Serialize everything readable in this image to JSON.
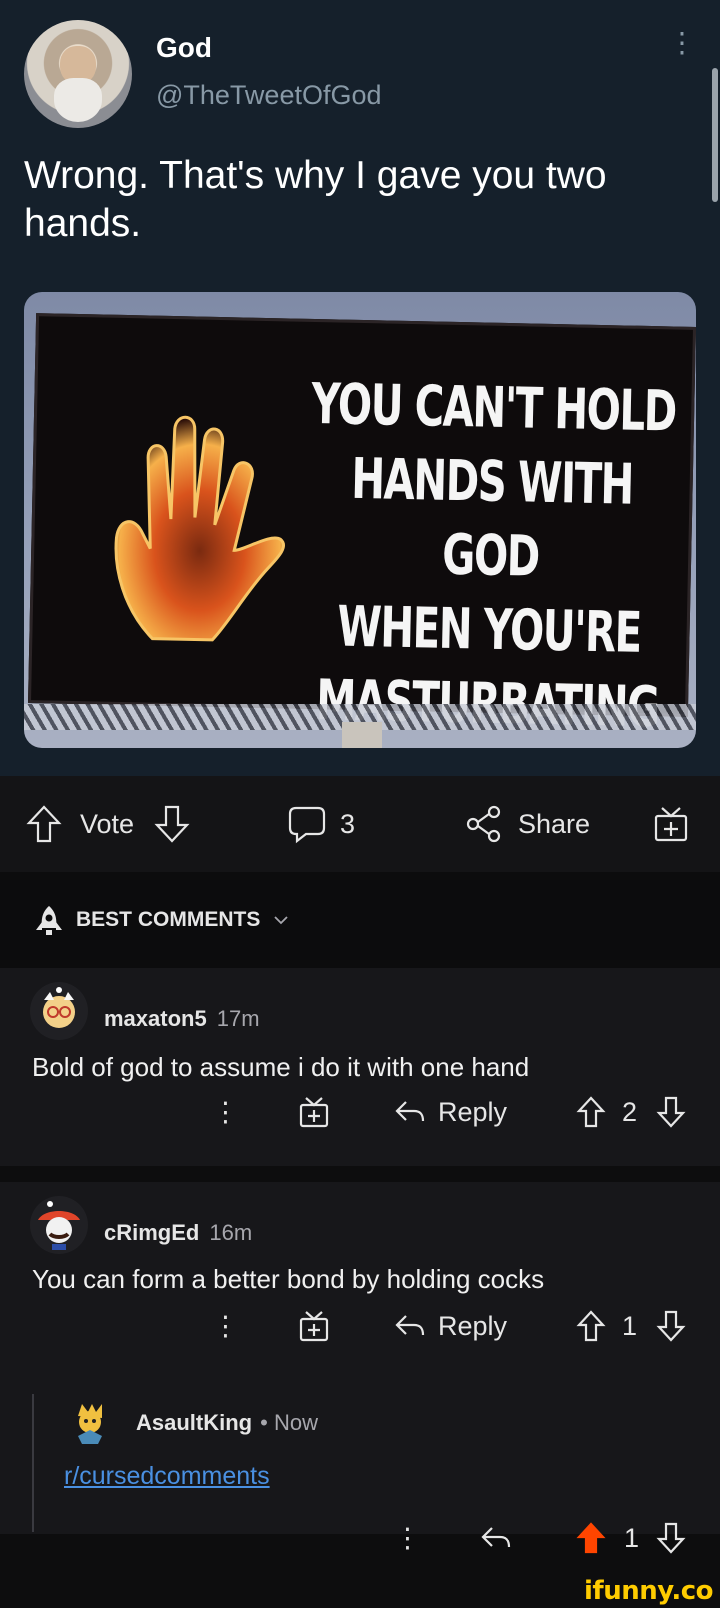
{
  "tweet": {
    "name": "God",
    "handle": "@TheTweetOfGod",
    "text": "Wrong. That's why I gave you two hands.",
    "billboard_lines": [
      "YOU CAN'T HOLD",
      "HANDS WITH GOD",
      "WHEN YOU'RE",
      "MASTURBATING"
    ]
  },
  "post_actions": {
    "vote_label": "Vote",
    "comment_count": "3",
    "share_label": "Share"
  },
  "comments_header": {
    "label": "BEST COMMENTS"
  },
  "comments": [
    {
      "user": "maxaton5",
      "time": "17m",
      "text": "Bold of god to assume i do it with one hand",
      "reply_label": "Reply",
      "score": "2"
    },
    {
      "user": "cRimgEd",
      "time": "16m",
      "text": "You can form a better bond by holding cocks",
      "reply_label": "Reply",
      "score": "1"
    }
  ],
  "reply": {
    "user": "AsaultKing",
    "time": "• Now",
    "link_text": "r/cursedcomments",
    "score": "1"
  },
  "colors": {
    "accent_upvote": "#ff4500",
    "link": "#4a90e2",
    "watermark": "#ffcc00"
  },
  "watermark": "ifunny.co"
}
